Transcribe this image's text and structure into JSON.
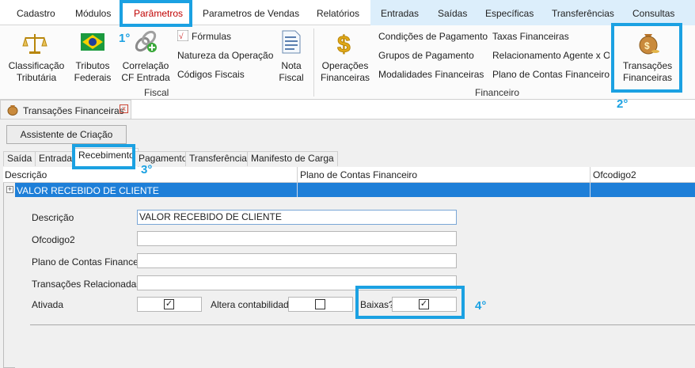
{
  "menu": {
    "items": [
      "Cadastro",
      "Módulos",
      "Parâmetros",
      "Parametros de Vendas",
      "Relatórios",
      "Entradas",
      "Saídas",
      "Específicas",
      "Transferências",
      "Consultas"
    ]
  },
  "ribbon": {
    "fiscal": {
      "classificacao": [
        "Classificação",
        "Tributária"
      ],
      "tributos": [
        "Tributos",
        "Federais"
      ],
      "correlacao": [
        "Correlação",
        "CF Entrada"
      ],
      "formulas": "Fórmulas",
      "natureza": "Natureza da Operação",
      "codigos": "Códigos Fiscais",
      "nota": [
        "Nota",
        "Fiscal"
      ],
      "group_label": "Fiscal"
    },
    "financeiro": {
      "operacoes": [
        "Operações",
        "Financeiras"
      ],
      "condicoes": "Condições de Pagamento",
      "grupos": "Grupos de Pagamento",
      "modalidades": "Modalidades Financeiras",
      "taxas": "Taxas Financeiras",
      "relacionamento": "Relacionamento Agente x O",
      "plano": "Plano de Contas Financeiro",
      "transacoes": [
        "Transações",
        "Financeiras"
      ],
      "group_label": "Financeiro"
    }
  },
  "doc_tab": {
    "label": "Transações Financeiras",
    "close": "x"
  },
  "assist_button": "Assistente de Criação",
  "sub_tabs": [
    "Saída",
    "Entrada",
    "Recebimento",
    "Pagamento",
    "Transferência",
    "Manifesto de Carga"
  ],
  "grid": {
    "columns": [
      "Descrição",
      "Plano de Contas Financeiro",
      "Ofcodigo2"
    ],
    "expander": "+",
    "row": {
      "descricao": "VALOR RECEBIDO DE CLIENTE"
    }
  },
  "form": {
    "descricao_label": "Descrição",
    "descricao_value": "VALOR RECEBIDO DE CLIENTE",
    "ofcodigo2_label": "Ofcodigo2",
    "plano_label": "Plano de Contas Financeiro",
    "transacoes_label": "Transações Relacionadas",
    "ativada_label": "Ativada",
    "ativada_mark": "✓",
    "altera_label": "Altera contabilidade",
    "baixas_label": "Baixas?",
    "baixas_mark": "✓"
  },
  "annotations": [
    "1°",
    "2°",
    "3°",
    "4°"
  ],
  "colors": {
    "accent": "#1ba1e2",
    "selection": "#1e7fd8",
    "active_menu": "#c00000"
  }
}
